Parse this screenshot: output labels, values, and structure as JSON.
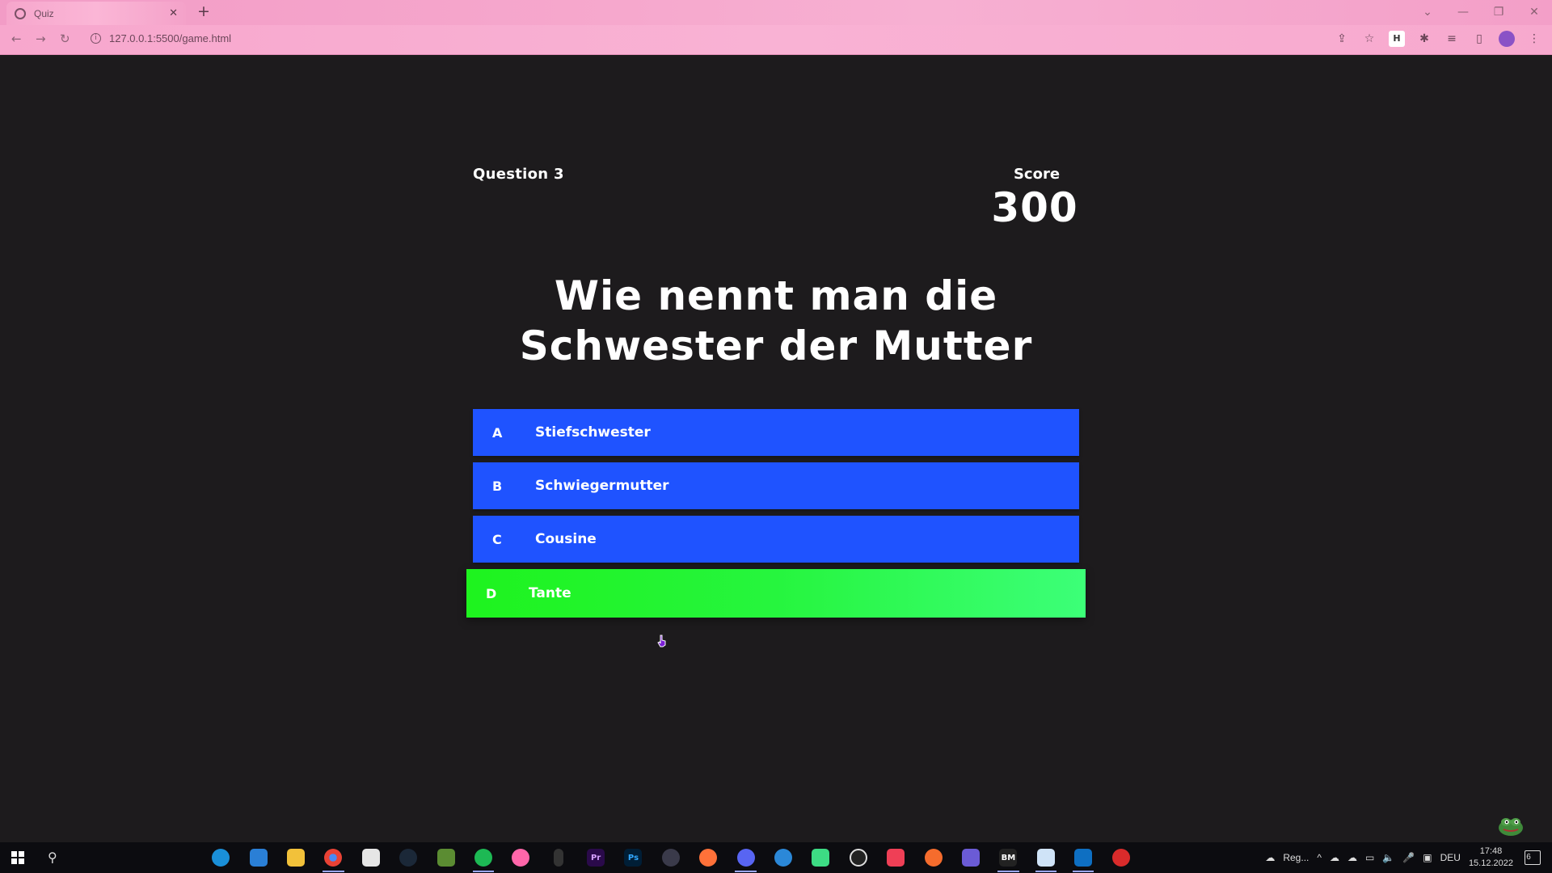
{
  "browser": {
    "tab_title": "Quiz",
    "tab_close": "✕",
    "new_tab": "+",
    "url": "127.0.0.1:5500/game.html",
    "window_controls": {
      "minimize": "—",
      "restore": "❐",
      "close": "✕",
      "tab_search": "⌄"
    }
  },
  "hud": {
    "question_label": "Question 3",
    "score_label": "Score",
    "score_value": "300"
  },
  "question": {
    "text": "Wie nennt man die Schwester der Mutter"
  },
  "answers": [
    {
      "letter": "A",
      "text": "Stiefschwester",
      "state": "default"
    },
    {
      "letter": "B",
      "text": "Schwiegermutter",
      "state": "default"
    },
    {
      "letter": "C",
      "text": "Cousine",
      "state": "default"
    },
    {
      "letter": "D",
      "text": "Tante",
      "state": "correct"
    }
  ],
  "colors": {
    "page_bg": "#1d1b1d",
    "answer_default": "#1f53ff",
    "answer_correct": "#26f53e",
    "browser_chrome": "#f7a9ce"
  },
  "taskbar": {
    "weather_text": "Reg...",
    "language": "DEU",
    "time": "17:48",
    "date": "15.12.2022",
    "notification_count": "6"
  }
}
